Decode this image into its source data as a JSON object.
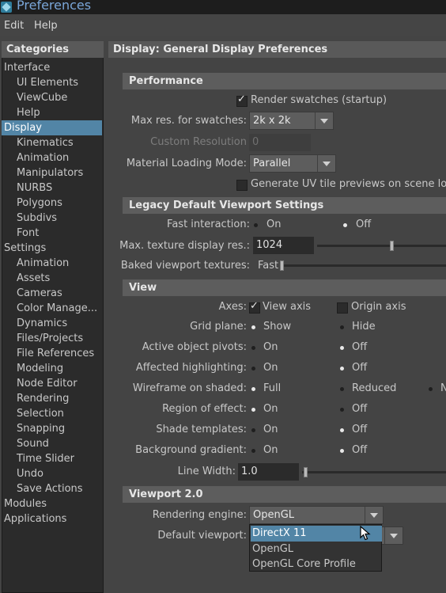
{
  "window": {
    "title": "Preferences"
  },
  "menu": {
    "items": [
      "Edit",
      "Help"
    ]
  },
  "sidebar": {
    "header": "Categories",
    "items": [
      {
        "label": "Interface",
        "level": 0
      },
      {
        "label": "UI Elements",
        "level": 1
      },
      {
        "label": "ViewCube",
        "level": 1
      },
      {
        "label": "Help",
        "level": 1
      },
      {
        "label": "Display",
        "level": 0,
        "selected": true
      },
      {
        "label": "Kinematics",
        "level": 1
      },
      {
        "label": "Animation",
        "level": 1
      },
      {
        "label": "Manipulators",
        "level": 1
      },
      {
        "label": "NURBS",
        "level": 1
      },
      {
        "label": "Polygons",
        "level": 1
      },
      {
        "label": "Subdivs",
        "level": 1
      },
      {
        "label": "Font",
        "level": 1
      },
      {
        "label": "Settings",
        "level": 0
      },
      {
        "label": "Animation",
        "level": 1
      },
      {
        "label": "Assets",
        "level": 1
      },
      {
        "label": "Cameras",
        "level": 1
      },
      {
        "label": "Color Manage...",
        "level": 1
      },
      {
        "label": "Dynamics",
        "level": 1
      },
      {
        "label": "Files/Projects",
        "level": 1
      },
      {
        "label": "File References",
        "level": 1
      },
      {
        "label": "Modeling",
        "level": 1
      },
      {
        "label": "Node Editor",
        "level": 1
      },
      {
        "label": "Rendering",
        "level": 1
      },
      {
        "label": "Selection",
        "level": 1
      },
      {
        "label": "Snapping",
        "level": 1
      },
      {
        "label": "Sound",
        "level": 1
      },
      {
        "label": "Time Slider",
        "level": 1
      },
      {
        "label": "Undo",
        "level": 1
      },
      {
        "label": "Save Actions",
        "level": 1
      },
      {
        "label": "Modules",
        "level": 0
      },
      {
        "label": "Applications",
        "level": 0
      }
    ]
  },
  "main": {
    "header": "Display: General Display Preferences",
    "performance": {
      "title": "Performance",
      "render_swatches": {
        "label": "Render swatches (startup)",
        "checked": true
      },
      "max_res": {
        "label": "Max res. for swatches:",
        "value": "2k x 2k"
      },
      "custom_res": {
        "label": "Custom Resolution",
        "value": "0"
      },
      "material_loading": {
        "label": "Material Loading Mode:",
        "value": "Parallel"
      },
      "uv_previews": {
        "label": "Generate UV tile previews on scene load",
        "checked": false
      }
    },
    "legacy": {
      "title": "Legacy Default Viewport Settings",
      "fast_interaction": {
        "label": "Fast interaction:",
        "on": "On",
        "off": "Off",
        "selected": "Off"
      },
      "max_texture": {
        "label": "Max. texture display res.:",
        "value": "1024",
        "level": 0.35
      },
      "baked": {
        "label": "Baked viewport textures:",
        "value": "Fast",
        "level": 0.0
      }
    },
    "view": {
      "title": "View",
      "axes": {
        "label": "Axes:",
        "view_axis": "View axis",
        "view_axis_checked": true,
        "origin_axis": "Origin axis",
        "origin_axis_checked": false
      },
      "grid_plane": {
        "label": "Grid plane:",
        "opt1": "Show",
        "opt2": "Hide",
        "selected": "Show"
      },
      "active_pivots": {
        "label": "Active object pivots:",
        "opt1": "On",
        "opt2": "Off",
        "selected": "Off"
      },
      "affected_highlighting": {
        "label": "Affected highlighting:",
        "opt1": "On",
        "opt2": "Off",
        "selected": "Off"
      },
      "wireframe_shaded": {
        "label": "Wireframe on shaded:",
        "opt1": "Full",
        "opt2": "Reduced",
        "opt3": "N",
        "selected": "Full"
      },
      "region_effect": {
        "label": "Region of effect:",
        "opt1": "On",
        "opt2": "Off",
        "selected": "On"
      },
      "shade_templates": {
        "label": "Shade templates:",
        "opt1": "On",
        "opt2": "Off",
        "selected": "Off"
      },
      "background_gradient": {
        "label": "Background gradient:",
        "opt1": "On",
        "opt2": "Off",
        "selected": "Off"
      },
      "line_width": {
        "label": "Line Width:",
        "value": "1.0",
        "level": 0.0
      }
    },
    "viewport2": {
      "title": "Viewport 2.0",
      "rendering_engine": {
        "label": "Rendering engine:",
        "value": "OpenGL"
      },
      "default_viewport": {
        "label": "Default viewport:"
      },
      "dropdown_options": [
        "DirectX 11",
        "OpenGL",
        "OpenGL Core Profile"
      ],
      "highlighted_option": "DirectX 11"
    }
  },
  "colors": {
    "selection": "#5285a6",
    "background": "#444444",
    "panel": "#2b2b2b",
    "section_header": "#5d5d5d"
  }
}
